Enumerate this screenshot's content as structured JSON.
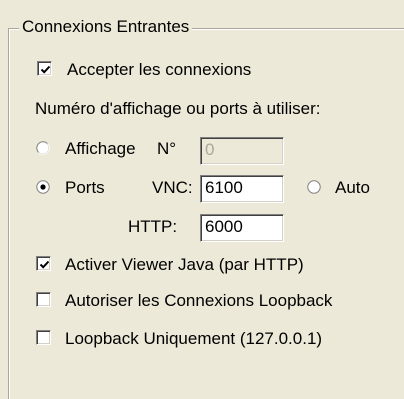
{
  "group": {
    "title": "Connexions Entrantes"
  },
  "accept_connections": {
    "label": "Accepter les connexions",
    "checked": true
  },
  "display_prompt": {
    "label": "Numéro d'affichage ou ports à utiliser:"
  },
  "display_option": {
    "label": "Affichage",
    "number_label": "N°",
    "value": "0",
    "selected": false
  },
  "ports_option": {
    "label": "Ports",
    "vnc_label": "VNC:",
    "vnc_value": "6100",
    "http_label": "HTTP:",
    "http_value": "6000",
    "selected": true
  },
  "auto_option": {
    "label": "Auto",
    "selected": false
  },
  "java_viewer": {
    "label": "Activer Viewer Java (par HTTP)",
    "checked": true
  },
  "allow_loopback": {
    "label": "Autoriser les Connexions Loopback",
    "checked": false
  },
  "loopback_only": {
    "label": "Loopback Uniquement (127.0.0.1)",
    "checked": false
  }
}
